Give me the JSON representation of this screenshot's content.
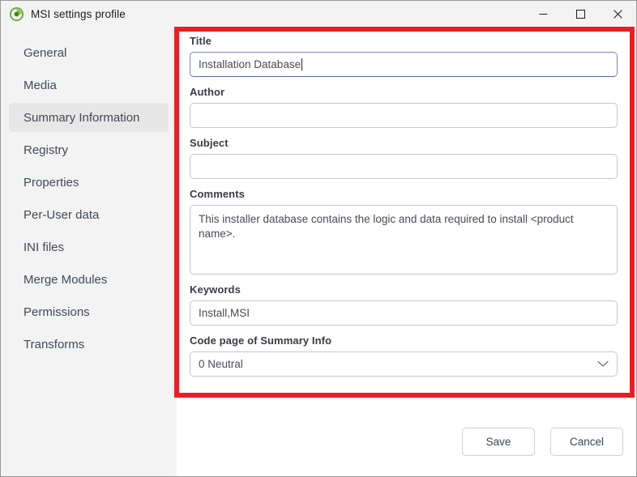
{
  "window": {
    "title": "MSI settings profile",
    "app_icon": "msi-profile-icon",
    "controls": {
      "minimize": "minimize-icon",
      "maximize": "maximize-icon",
      "close": "close-icon"
    }
  },
  "sidebar": {
    "items": [
      {
        "label": "General",
        "selected": false
      },
      {
        "label": "Media",
        "selected": false
      },
      {
        "label": "Summary Information",
        "selected": true
      },
      {
        "label": "Registry",
        "selected": false
      },
      {
        "label": "Properties",
        "selected": false
      },
      {
        "label": "Per-User data",
        "selected": false
      },
      {
        "label": "INI files",
        "selected": false
      },
      {
        "label": "Merge Modules",
        "selected": false
      },
      {
        "label": "Permissions",
        "selected": false
      },
      {
        "label": "Transforms",
        "selected": false
      }
    ]
  },
  "form": {
    "title": {
      "label": "Title",
      "value": "Installation Database",
      "placeholder": "",
      "focused": true
    },
    "author": {
      "label": "Author",
      "value": "",
      "placeholder": ""
    },
    "subject": {
      "label": "Subject",
      "value": "",
      "placeholder": ""
    },
    "comments": {
      "label": "Comments",
      "value": "This installer database contains the logic and data required to install  <product name>.",
      "placeholder": ""
    },
    "keywords": {
      "label": "Keywords",
      "value": "Install,MSI",
      "placeholder": ""
    },
    "codepage": {
      "label": "Code page of Summary Info",
      "value": "0 Neutral",
      "chevron": "chevron-down-icon"
    }
  },
  "footer": {
    "save_label": "Save",
    "cancel_label": "Cancel"
  },
  "colors": {
    "accent_focus": "#5a64b4",
    "annotation": "#ed1c24",
    "sidebar_bg": "#f3f3f3",
    "selected_bg": "#e7e7e7",
    "icon_green": "#6aa83b"
  }
}
